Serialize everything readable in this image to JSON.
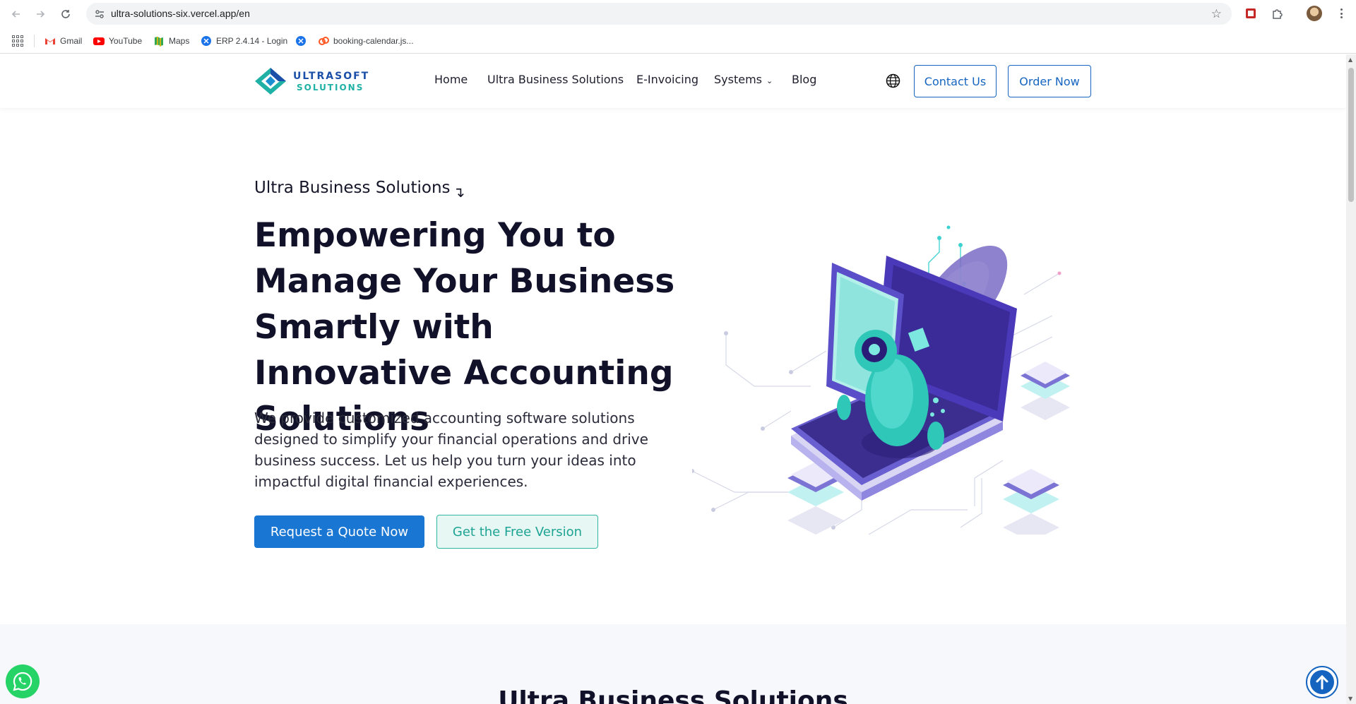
{
  "browser": {
    "url": "ultra-solutions-six.vercel.app/en",
    "bookmarks": [
      {
        "label": "Gmail",
        "icon": "gmail-icon",
        "color": "#ea4335"
      },
      {
        "label": "YouTube",
        "icon": "youtube-icon",
        "color": "#ff0000"
      },
      {
        "label": "Maps",
        "icon": "maps-icon",
        "color": "#34a853"
      },
      {
        "label": "ERP 2.4.14 - Login",
        "icon": "erp-icon",
        "color": "#1a73e8"
      },
      {
        "label": "",
        "icon": "erp-icon",
        "color": "#1a73e8"
      },
      {
        "label": "booking-calendar.js...",
        "icon": "booking-icon",
        "color": "#ff5722"
      }
    ]
  },
  "header": {
    "logo_line1": "ULTRASOFT",
    "logo_line2": "SOLUTIONS",
    "nav": {
      "home": "Home",
      "ubs": "Ultra Business Solutions",
      "einvoicing": "E-Invoicing",
      "systems": "Systems",
      "blog": "Blog"
    },
    "contact": "Contact Us",
    "order": "Order Now"
  },
  "hero": {
    "eyebrow": "Ultra Business Solutions",
    "title": "Empowering You to Manage Your Business Smartly with Innovative Accounting Solutions",
    "description": "We provide customized accounting software solutions designed to simplify your financial operations and drive business success. Let us help you turn your ideas into impactful digital financial experiences.",
    "primary_cta": "Request a Quote Now",
    "secondary_cta": "Get the Free Version"
  },
  "next_section": {
    "title": "Ultra Business Solutions"
  },
  "colors": {
    "primary": "#1976d2",
    "teal": "#1fb1a5",
    "dark_text": "#111129",
    "whatsapp": "#25d366"
  }
}
